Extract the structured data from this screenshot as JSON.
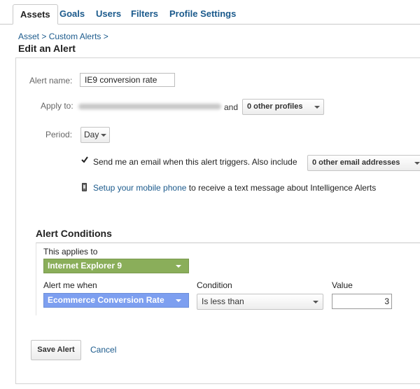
{
  "tabs": [
    {
      "label": "Assets",
      "active": true
    },
    {
      "label": "Goals"
    },
    {
      "label": "Users"
    },
    {
      "label": "Filters"
    },
    {
      "label": "Profile Settings"
    }
  ],
  "breadcrumb": [
    "Asset",
    "Custom Alerts"
  ],
  "breadcrumb_sep": ">",
  "page_title": "Edit an Alert",
  "form": {
    "alert_name_label": "Alert name:",
    "alert_name_value": "IE9 conversion rate",
    "apply_to_label": "Apply to:",
    "apply_to_and": "and",
    "profiles_select": "0 other profiles",
    "period_label": "Period:",
    "period_value": "Day",
    "email_text": "Send me an email when this alert triggers. Also include",
    "email_checked": true,
    "email_select": "0 other email addresses",
    "mobile_link": "Setup your mobile phone",
    "mobile_text": " to receive a text message about Intelligence Alerts"
  },
  "conditions": {
    "title": "Alert Conditions",
    "applies_to_label": "This applies to",
    "applies_to_value": "Internet Explorer 9",
    "alert_when_label": "Alert me when",
    "alert_when_value": "Ecommerce Conversion Rate",
    "condition_label": "Condition",
    "condition_value": "Is less than",
    "value_label": "Value",
    "value_value": "3"
  },
  "actions": {
    "save_label": "Save Alert",
    "cancel_label": "Cancel"
  },
  "colors": {
    "link": "#1b5a8c",
    "segment_green": "#8aae5a",
    "metric_blue": "#7d9ff0"
  },
  "icons": [
    "checkbox-checked-icon",
    "mobile-phone-icon",
    "dropdown-caret-icon"
  ]
}
